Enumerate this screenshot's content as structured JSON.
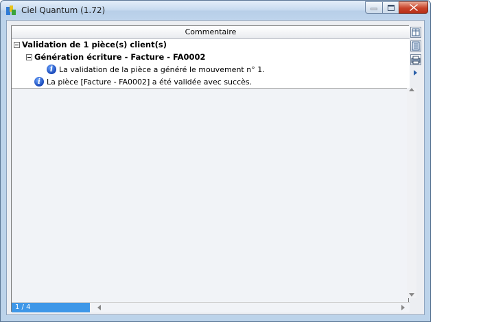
{
  "window": {
    "title": "Ciel Quantum (1.72)"
  },
  "grid": {
    "column_header": "Commentaire",
    "rows": [
      {
        "level": 0,
        "text": "Validation de 1 pièce(s) client(s)",
        "icon": "minus-expander-icon"
      },
      {
        "level": 1,
        "text": "Génération écriture - Facture - FA0002",
        "icon": "minus-expander-icon"
      },
      {
        "level": 2,
        "text": "La validation de la pièce a généré le mouvement n° 1.",
        "icon": "info-icon"
      },
      {
        "level": 1,
        "text": "La pièce [Facture - FA0002] a été validée avec succès.",
        "icon": "info-icon"
      }
    ]
  },
  "status": {
    "page_indicator": "1 / 4"
  },
  "side_toolbar": [
    "columns-config-icon",
    "export-icon",
    "print-icon",
    "expand-arrow-icon"
  ],
  "colors": {
    "window_frame": "#bcd3ea",
    "page_indicator_bg": "#3e97e8",
    "close_button": "#c9442b",
    "info_icon": "#1746b8"
  }
}
